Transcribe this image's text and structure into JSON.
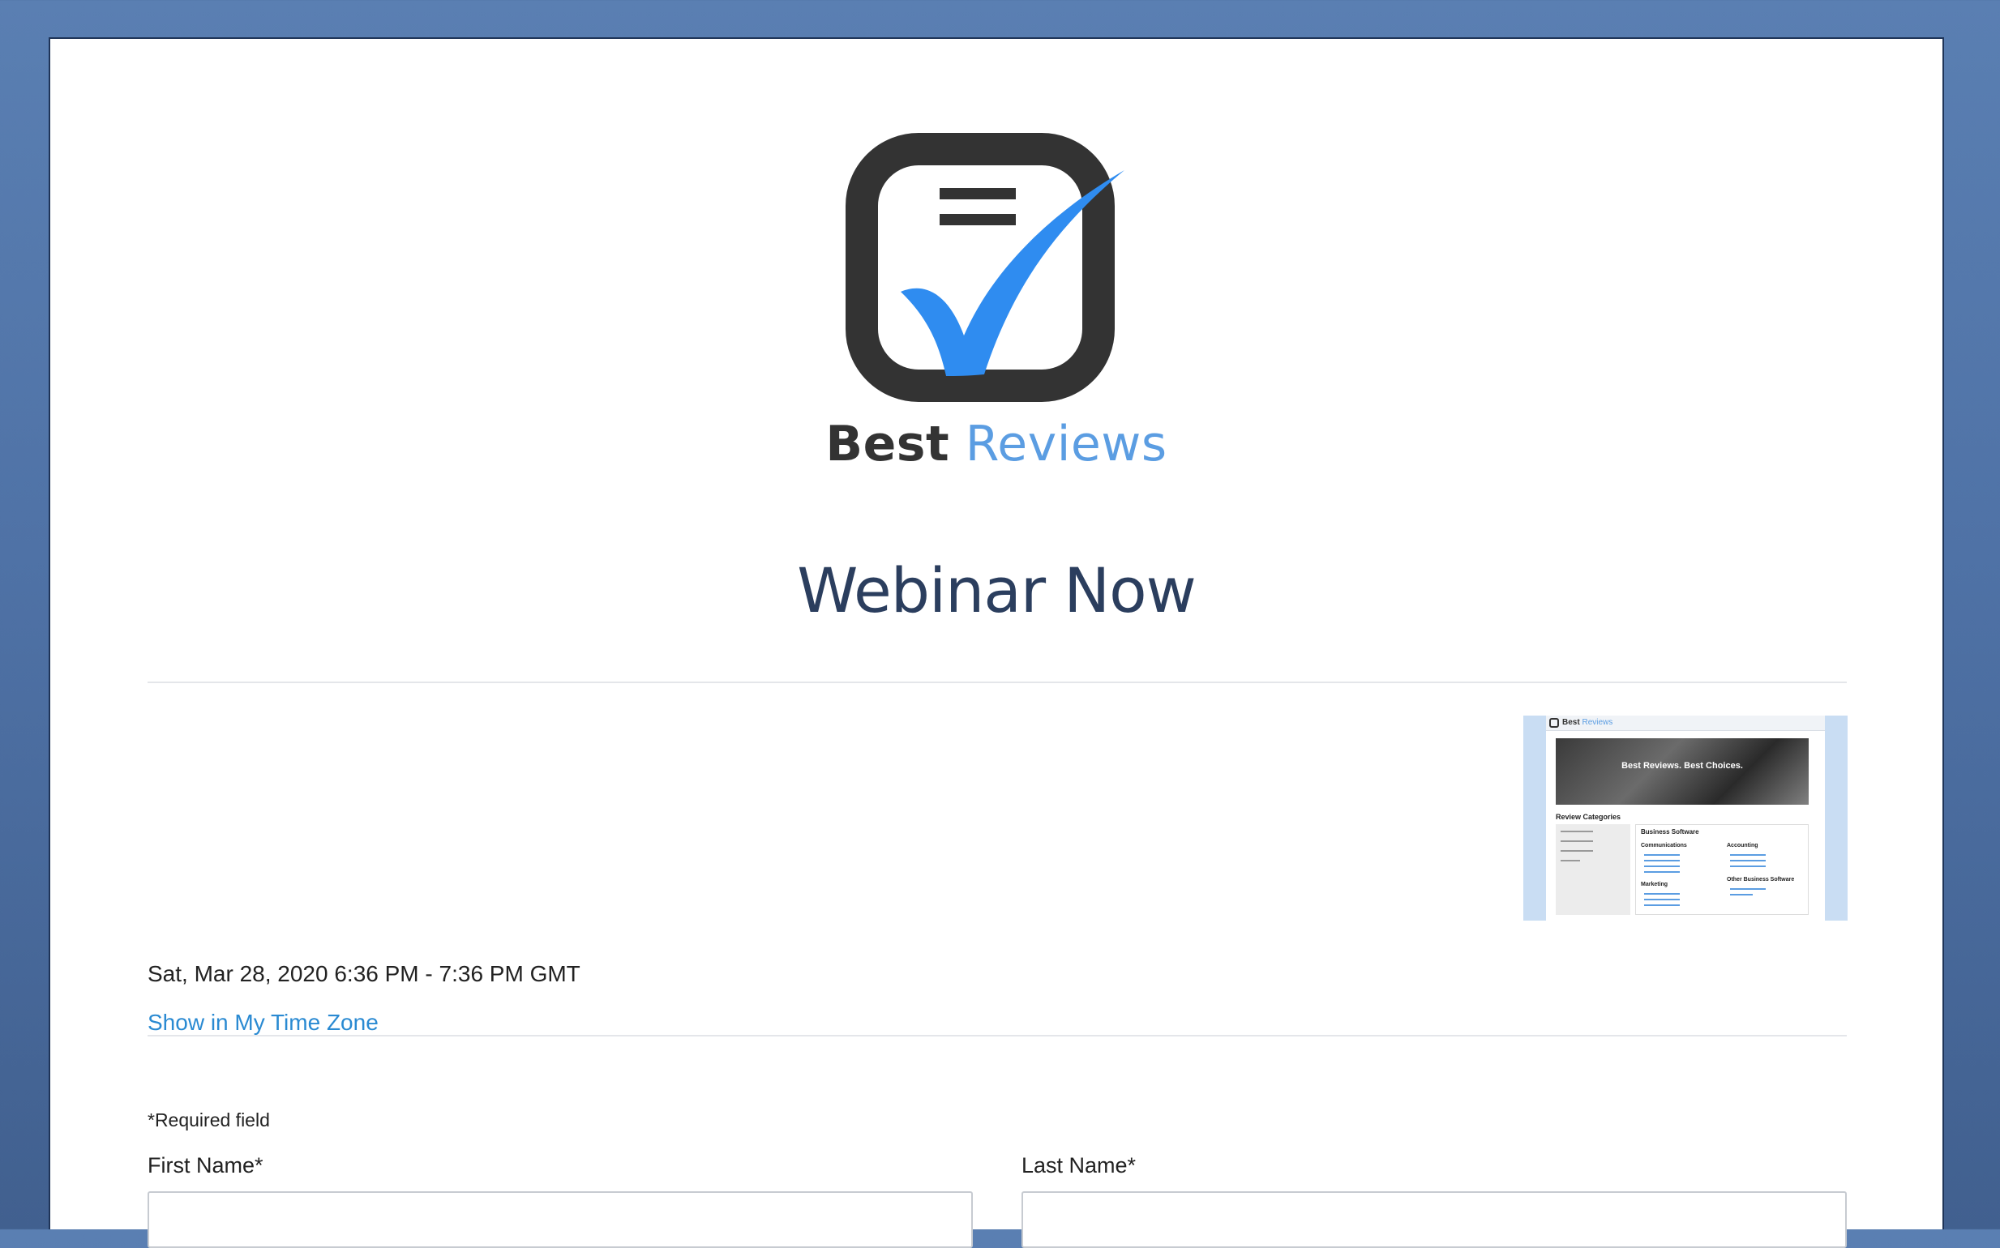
{
  "brand": {
    "name_part1": "Best",
    "name_part2": "Reviews",
    "colors": {
      "dark": "#333333",
      "accent": "#5b9de2"
    },
    "logo_icon": "checklist-checkmark-icon"
  },
  "page": {
    "title": "Webinar Now"
  },
  "event": {
    "date_range": "Sat, Mar 28, 2020 6:36 PM - 7:36 PM GMT",
    "timezone_link": "Show in My Time Zone",
    "thumbnail": {
      "brand_part1": "Best",
      "brand_part2": "Reviews",
      "hero_text": "Best Reviews. Best Choices.",
      "section_heading": "Review Categories",
      "panel_heading": "Business Software",
      "col1_heading": "Communications",
      "col2_heading": "Accounting",
      "col3_heading": "Marketing",
      "col4_heading": "Other Business Software"
    }
  },
  "form": {
    "required_note": "*Required field",
    "first_name_label": "First Name*",
    "last_name_label": "Last Name*",
    "first_name_value": "",
    "last_name_value": ""
  }
}
